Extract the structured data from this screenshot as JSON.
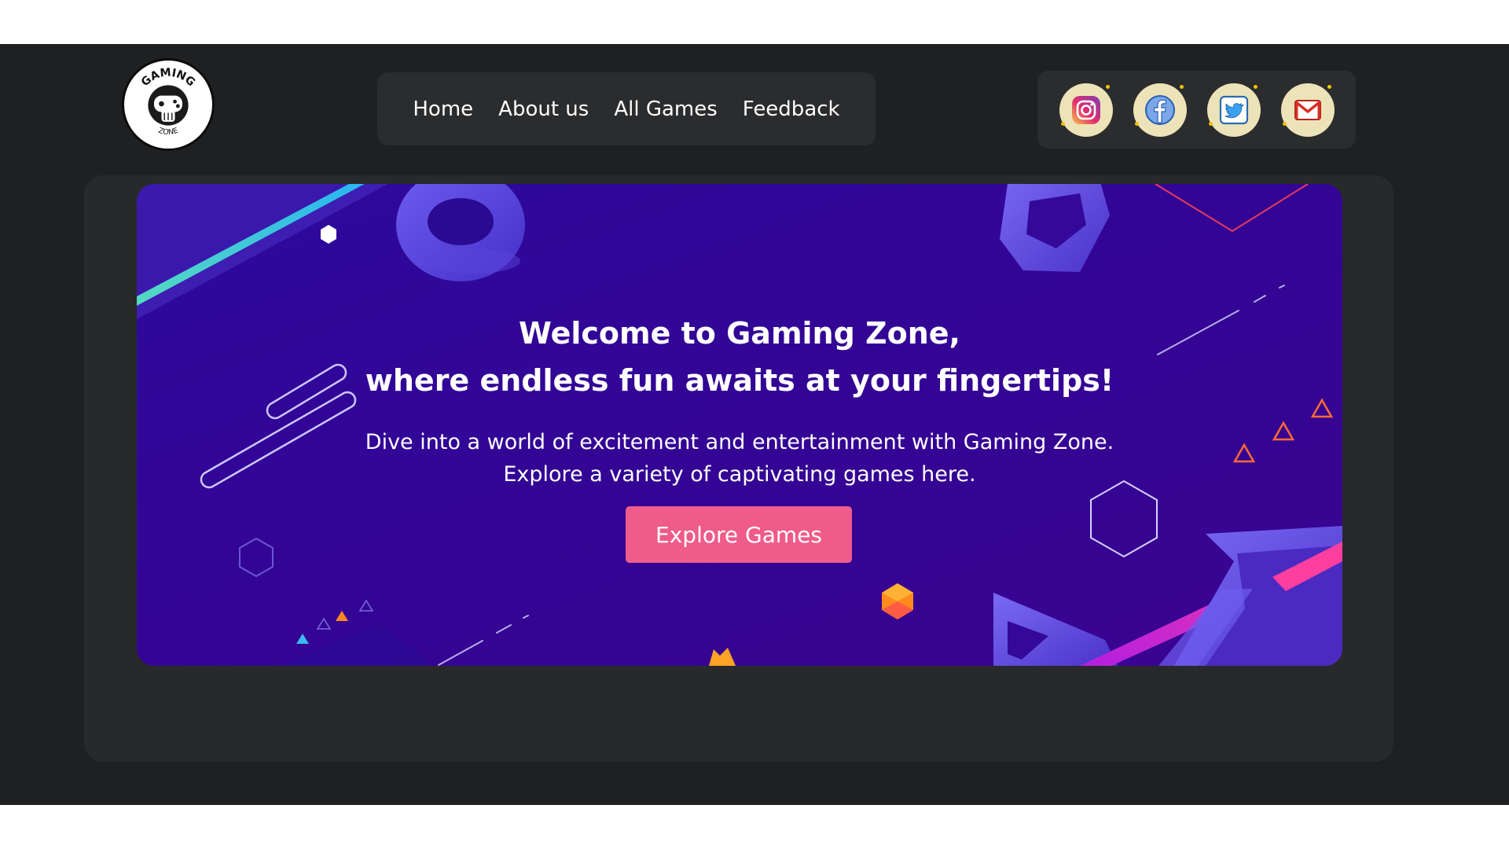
{
  "logo": {
    "text_top": "GAMING",
    "text_bottom": "ZONE"
  },
  "nav": {
    "links": [
      "Home",
      "About us",
      "All Games",
      "Feedback"
    ]
  },
  "social": [
    {
      "name": "instagram",
      "icon": "instagram-icon",
      "color": "#d6249f"
    },
    {
      "name": "facebook",
      "icon": "facebook-icon",
      "color": "#1877f2"
    },
    {
      "name": "twitter",
      "icon": "twitter-icon",
      "color": "#1da1f2"
    },
    {
      "name": "gmail",
      "icon": "gmail-icon",
      "color": "#d93025"
    }
  ],
  "hero": {
    "title_line1": "Welcome to Gaming Zone,",
    "title_line2": "where endless fun awaits at your fingertips!",
    "desc_line1": "Dive into a world of excitement and entertainment with Gaming Zone.",
    "desc_line2": "Explore a variety of captivating games here.",
    "cta_label": "Explore Games"
  },
  "colors": {
    "page_bg": "#1f2021",
    "panel_bg": "#28292b",
    "hero_bg": "#34069a",
    "cta_bg": "#ef5b8a",
    "icon_bg": "#ede3b8"
  }
}
